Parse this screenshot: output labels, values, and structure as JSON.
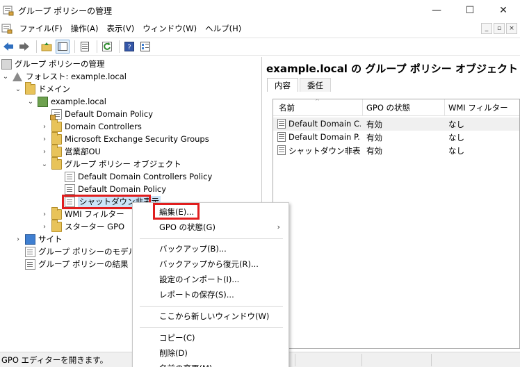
{
  "window": {
    "title": "グループ ポリシーの管理",
    "controls": [
      "—",
      "☐",
      "✕"
    ]
  },
  "menubar": {
    "items": [
      "ファイル(F)",
      "操作(A)",
      "表示(V)",
      "ウィンドウ(W)",
      "ヘルプ(H)"
    ],
    "mdi_controls": [
      "_",
      "▫",
      "×"
    ]
  },
  "toolbar": {
    "buttons": [
      "back-icon",
      "forward-icon",
      "up-folder-icon",
      "show-hide-tree-icon",
      "properties-icon",
      "refresh-icon",
      "help-icon",
      "view-icon"
    ]
  },
  "tree": {
    "root": "グループ ポリシーの管理",
    "forest": "フォレスト: example.local",
    "domains": "ドメイン",
    "domain": "example.local",
    "ddp_link": "Default Domain Policy",
    "ou_dc": "Domain Controllers",
    "ou_mesg": "Microsoft Exchange Security Groups",
    "ou_sales": "営業部OU",
    "gpo_container": "グループ ポリシー オブジェクト",
    "gpo_ddcp": "Default Domain Controllers Policy",
    "gpo_ddp": "Default Domain Policy",
    "gpo_shutdown": "シャットダウン非表示",
    "wmi": "WMI フィルター",
    "starter": "スターター GPO",
    "sites": "サイト",
    "modeling": "グループ ポリシーのモデル作成",
    "results": "グループ ポリシーの結果"
  },
  "right": {
    "title": "example.local の グループ ポリシー オブジェクト",
    "tabs": [
      "内容",
      "委任"
    ],
    "columns": [
      "名前",
      "GPO の状態",
      "WMI フィルター"
    ],
    "rows": [
      {
        "name": "Default Domain C...",
        "status": "有効",
        "wmi": "なし"
      },
      {
        "name": "Default Domain P...",
        "status": "有効",
        "wmi": "なし"
      },
      {
        "name": "シャットダウン非表示",
        "status": "有効",
        "wmi": "なし"
      }
    ]
  },
  "context_menu": {
    "edit": "編集(E)...",
    "gpo_status": "GPO の状態(G)",
    "backup": "バックアップ(B)...",
    "restore": "バックアップから復元(R)...",
    "import": "設定のインポート(I)...",
    "save_report": "レポートの保存(S)...",
    "new_window": "ここから新しいウィンドウ(W)",
    "copy": "コピー(C)",
    "delete": "削除(D)",
    "rename": "名前の変更(M)"
  },
  "status": {
    "text": "GPO エディターを開きます。"
  },
  "colors": {
    "highlight_red": "#e01e1e",
    "selection_blue": "#cce4f7"
  }
}
